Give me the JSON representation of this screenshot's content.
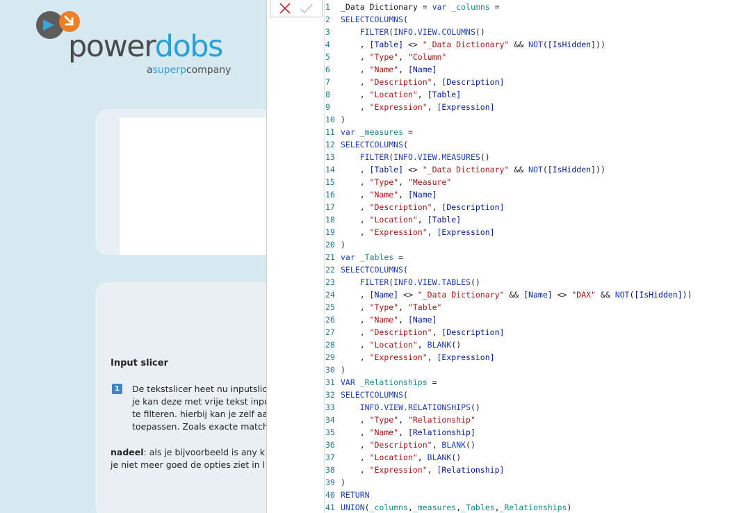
{
  "brand": {
    "logo_text_part1": "power",
    "logo_text_part2": "dobs",
    "tagline_a": "a",
    "tagline_brand": "superp",
    "tagline_rest": "company"
  },
  "report": {
    "heading": "Input slicer",
    "badge": "1",
    "paragraph_lines": [
      "De tekstslicer heet nu inputslic",
      "je kan deze met vrije tekst inpu",
      "te filteren. hierbij kan je zelf aa",
      "toepassen. Zoals exacte match"
    ],
    "note_label": "nadeel",
    "note_line1": ":  als je bijvoorbeeld is any k",
    "note_line2": "je niet meer goed de opties ziet in l"
  },
  "editor": {
    "cancel_icon": "x-icon",
    "confirm_icon": "check-icon",
    "colors": {
      "keyword": "#1d3fb0",
      "string": "#a31515",
      "column": "#001a8a",
      "variable": "#128b8b",
      "line_number": "#237893"
    },
    "lines": [
      {
        "n": "1",
        "tokens": [
          [
            "tx",
            "_Data Dictionary = "
          ],
          [
            "kw",
            "var"
          ],
          [
            "tx",
            " "
          ],
          [
            "vr",
            "_columns"
          ],
          [
            "tx",
            " ="
          ]
        ]
      },
      {
        "n": "2",
        "tokens": [
          [
            "fn",
            "SELECTCOLUMNS"
          ],
          [
            "tx",
            "("
          ]
        ]
      },
      {
        "n": "3",
        "tokens": [
          [
            "tx",
            "    "
          ],
          [
            "fn",
            "FILTER"
          ],
          [
            "tx",
            "("
          ],
          [
            "fn",
            "INFO.VIEW.COLUMNS"
          ],
          [
            "tx",
            "()"
          ]
        ]
      },
      {
        "n": "4",
        "tokens": [
          [
            "tx",
            "    , "
          ],
          [
            "cl",
            "[Table]"
          ],
          [
            "tx",
            " <> "
          ],
          [
            "st",
            "\"_Data Dictionary\""
          ],
          [
            "tx",
            " && "
          ],
          [
            "fn",
            "NOT"
          ],
          [
            "tx",
            "("
          ],
          [
            "cl",
            "[IsHidden]"
          ],
          [
            "tx",
            "))"
          ]
        ]
      },
      {
        "n": "5",
        "tokens": [
          [
            "tx",
            "    , "
          ],
          [
            "st",
            "\"Type\""
          ],
          [
            "tx",
            ", "
          ],
          [
            "st",
            "\"Column\""
          ]
        ]
      },
      {
        "n": "6",
        "tokens": [
          [
            "tx",
            "    , "
          ],
          [
            "st",
            "\"Name\""
          ],
          [
            "tx",
            ", "
          ],
          [
            "cl",
            "[Name]"
          ]
        ]
      },
      {
        "n": "7",
        "tokens": [
          [
            "tx",
            "    , "
          ],
          [
            "st",
            "\"Description\""
          ],
          [
            "tx",
            ", "
          ],
          [
            "cl",
            "[Description]"
          ]
        ]
      },
      {
        "n": "8",
        "tokens": [
          [
            "tx",
            "    , "
          ],
          [
            "st",
            "\"Location\""
          ],
          [
            "tx",
            ", "
          ],
          [
            "cl",
            "[Table]"
          ]
        ]
      },
      {
        "n": "9",
        "tokens": [
          [
            "tx",
            "    , "
          ],
          [
            "st",
            "\"Expression\""
          ],
          [
            "tx",
            ", "
          ],
          [
            "cl",
            "[Expression]"
          ]
        ]
      },
      {
        "n": "10",
        "tokens": [
          [
            "tx",
            ")"
          ]
        ]
      },
      {
        "n": "11",
        "tokens": [
          [
            "kw",
            "var"
          ],
          [
            "tx",
            " "
          ],
          [
            "vr",
            "_measures"
          ],
          [
            "tx",
            " ="
          ]
        ]
      },
      {
        "n": "12",
        "tokens": [
          [
            "fn",
            "SELECTCOLUMNS"
          ],
          [
            "tx",
            "("
          ]
        ]
      },
      {
        "n": "13",
        "tokens": [
          [
            "tx",
            "    "
          ],
          [
            "fn",
            "FILTER"
          ],
          [
            "tx",
            "("
          ],
          [
            "fn",
            "INFO.VIEW.MEASURES"
          ],
          [
            "tx",
            "()"
          ]
        ]
      },
      {
        "n": "14",
        "tokens": [
          [
            "tx",
            "    , "
          ],
          [
            "cl",
            "[Table]"
          ],
          [
            "tx",
            " <> "
          ],
          [
            "st",
            "\"_Data Dictionary\""
          ],
          [
            "tx",
            " && "
          ],
          [
            "fn",
            "NOT"
          ],
          [
            "tx",
            "("
          ],
          [
            "cl",
            "[IsHidden]"
          ],
          [
            "tx",
            "))"
          ]
        ]
      },
      {
        "n": "15",
        "tokens": [
          [
            "tx",
            "    , "
          ],
          [
            "st",
            "\"Type\""
          ],
          [
            "tx",
            ", "
          ],
          [
            "st",
            "\"Measure\""
          ]
        ]
      },
      {
        "n": "16",
        "tokens": [
          [
            "tx",
            "    , "
          ],
          [
            "st",
            "\"Name\""
          ],
          [
            "tx",
            ", "
          ],
          [
            "cl",
            "[Name]"
          ]
        ]
      },
      {
        "n": "17",
        "tokens": [
          [
            "tx",
            "    , "
          ],
          [
            "st",
            "\"Description\""
          ],
          [
            "tx",
            ", "
          ],
          [
            "cl",
            "[Description]"
          ]
        ]
      },
      {
        "n": "18",
        "tokens": [
          [
            "tx",
            "    , "
          ],
          [
            "st",
            "\"Location\""
          ],
          [
            "tx",
            ", "
          ],
          [
            "cl",
            "[Table]"
          ]
        ]
      },
      {
        "n": "19",
        "tokens": [
          [
            "tx",
            "    , "
          ],
          [
            "st",
            "\"Expression\""
          ],
          [
            "tx",
            ", "
          ],
          [
            "cl",
            "[Expression]"
          ]
        ]
      },
      {
        "n": "20",
        "tokens": [
          [
            "tx",
            ")"
          ]
        ]
      },
      {
        "n": "21",
        "tokens": [
          [
            "kw",
            "var"
          ],
          [
            "tx",
            " "
          ],
          [
            "vr",
            "_Tables"
          ],
          [
            "tx",
            " ="
          ]
        ]
      },
      {
        "n": "22",
        "tokens": [
          [
            "fn",
            "SELECTCOLUMNS"
          ],
          [
            "tx",
            "("
          ]
        ]
      },
      {
        "n": "23",
        "tokens": [
          [
            "tx",
            "    "
          ],
          [
            "fn",
            "FILTER"
          ],
          [
            "tx",
            "("
          ],
          [
            "fn",
            "INFO.VIEW.TABLES"
          ],
          [
            "tx",
            "()"
          ]
        ]
      },
      {
        "n": "24",
        "tokens": [
          [
            "tx",
            "    , "
          ],
          [
            "cl",
            "[Name]"
          ],
          [
            "tx",
            " <> "
          ],
          [
            "st",
            "\"_Data Dictionary\""
          ],
          [
            "tx",
            " && "
          ],
          [
            "cl",
            "[Name]"
          ],
          [
            "tx",
            " <> "
          ],
          [
            "st",
            "\"DAX\""
          ],
          [
            "tx",
            " && "
          ],
          [
            "fn",
            "NOT"
          ],
          [
            "tx",
            "("
          ],
          [
            "cl",
            "[IsHidden]"
          ],
          [
            "tx",
            "))"
          ]
        ]
      },
      {
        "n": "25",
        "tokens": [
          [
            "tx",
            "    , "
          ],
          [
            "st",
            "\"Type\""
          ],
          [
            "tx",
            ", "
          ],
          [
            "st",
            "\"Table\""
          ]
        ]
      },
      {
        "n": "26",
        "tokens": [
          [
            "tx",
            "    , "
          ],
          [
            "st",
            "\"Name\""
          ],
          [
            "tx",
            ", "
          ],
          [
            "cl",
            "[Name]"
          ]
        ]
      },
      {
        "n": "27",
        "tokens": [
          [
            "tx",
            "    , "
          ],
          [
            "st",
            "\"Description\""
          ],
          [
            "tx",
            ", "
          ],
          [
            "cl",
            "[Description]"
          ]
        ]
      },
      {
        "n": "28",
        "tokens": [
          [
            "tx",
            "    , "
          ],
          [
            "st",
            "\"Location\""
          ],
          [
            "tx",
            ", "
          ],
          [
            "fn",
            "BLANK"
          ],
          [
            "tx",
            "()"
          ]
        ]
      },
      {
        "n": "29",
        "tokens": [
          [
            "tx",
            "    , "
          ],
          [
            "st",
            "\"Expression\""
          ],
          [
            "tx",
            ", "
          ],
          [
            "cl",
            "[Expression]"
          ]
        ]
      },
      {
        "n": "30",
        "tokens": [
          [
            "tx",
            ")"
          ]
        ]
      },
      {
        "n": "31",
        "tokens": [
          [
            "kw",
            "VAR"
          ],
          [
            "tx",
            " "
          ],
          [
            "vr",
            "_Relationships"
          ],
          [
            "tx",
            " ="
          ]
        ]
      },
      {
        "n": "32",
        "tokens": [
          [
            "fn",
            "SELECTCOLUMNS"
          ],
          [
            "tx",
            "("
          ]
        ]
      },
      {
        "n": "33",
        "tokens": [
          [
            "tx",
            "    "
          ],
          [
            "fn",
            "INFO.VIEW.RELATIONSHIPS"
          ],
          [
            "tx",
            "()"
          ]
        ]
      },
      {
        "n": "34",
        "tokens": [
          [
            "tx",
            "    , "
          ],
          [
            "st",
            "\"Type\""
          ],
          [
            "tx",
            ", "
          ],
          [
            "st",
            "\"Relationship\""
          ]
        ]
      },
      {
        "n": "35",
        "tokens": [
          [
            "tx",
            "    , "
          ],
          [
            "st",
            "\"Name\""
          ],
          [
            "tx",
            ", "
          ],
          [
            "cl",
            "[Relationship]"
          ]
        ]
      },
      {
        "n": "36",
        "tokens": [
          [
            "tx",
            "    , "
          ],
          [
            "st",
            "\"Description\""
          ],
          [
            "tx",
            ", "
          ],
          [
            "fn",
            "BLANK"
          ],
          [
            "tx",
            "()"
          ]
        ]
      },
      {
        "n": "37",
        "tokens": [
          [
            "tx",
            "    , "
          ],
          [
            "st",
            "\"Location\""
          ],
          [
            "tx",
            ", "
          ],
          [
            "fn",
            "BLANK"
          ],
          [
            "tx",
            "()"
          ]
        ]
      },
      {
        "n": "38",
        "tokens": [
          [
            "tx",
            "    , "
          ],
          [
            "st",
            "\"Expression\""
          ],
          [
            "tx",
            ", "
          ],
          [
            "cl",
            "[Relationship]"
          ]
        ]
      },
      {
        "n": "39",
        "tokens": [
          [
            "tx",
            ")"
          ]
        ]
      },
      {
        "n": "40",
        "tokens": [
          [
            "kw",
            "RETURN"
          ]
        ]
      },
      {
        "n": "41",
        "tokens": [
          [
            "fn",
            "UNION"
          ],
          [
            "tx",
            "("
          ],
          [
            "vr",
            "_columns"
          ],
          [
            "tx",
            ","
          ],
          [
            "vr",
            "_measures"
          ],
          [
            "tx",
            ","
          ],
          [
            "vr",
            "_Tables"
          ],
          [
            "tx",
            ","
          ],
          [
            "vr",
            "_Relationships"
          ],
          [
            "tx",
            ")"
          ]
        ]
      }
    ]
  }
}
